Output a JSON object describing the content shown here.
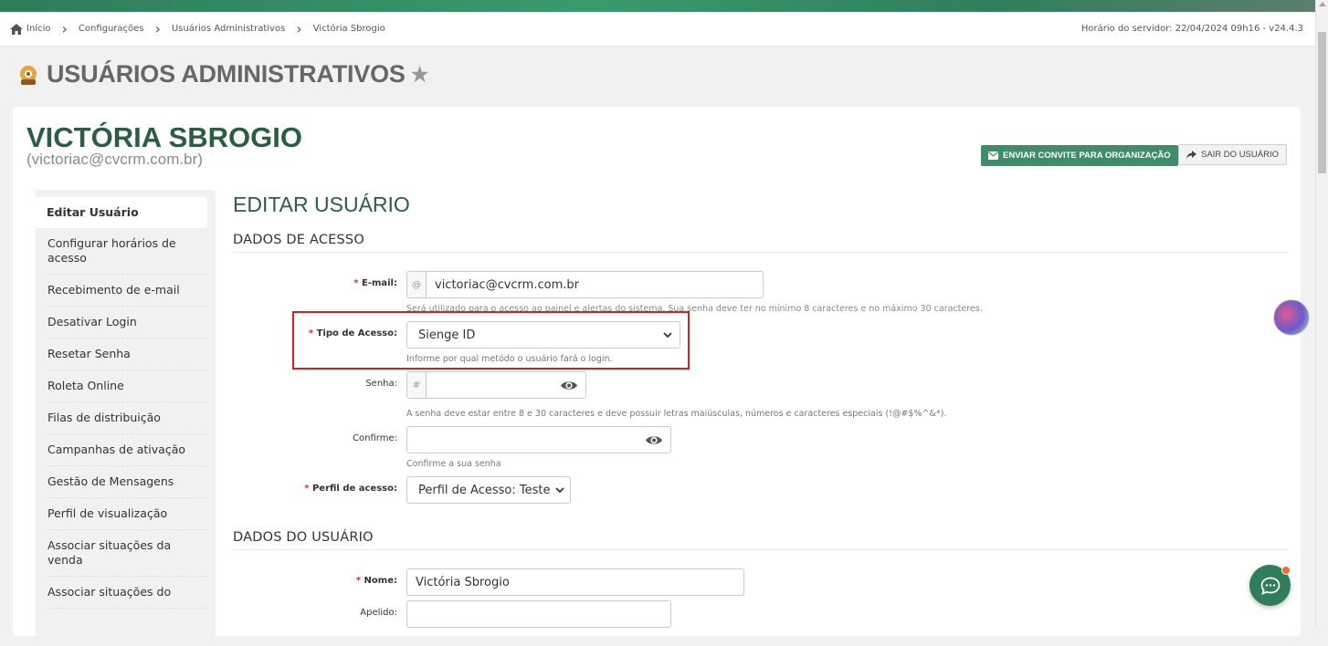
{
  "breadcrumb": {
    "items": [
      "Início",
      "Configurações",
      "Usuários Administrativos",
      "Victória Sbrogio"
    ],
    "server_time": "Horário do servidor: 22/04/2024 09h16 - v24.4.3"
  },
  "header": {
    "title": "USUÁRIOS ADMINISTRATIVOS"
  },
  "user": {
    "name": "VICTÓRIA SBROGIO",
    "email": "(victoriac@cvcrm.com.br)",
    "invite_button": "ENVIAR CONVITE PARA ORGANIZAÇÃO",
    "logout_button": "SAIR DO USUÁRIO"
  },
  "sidebar": {
    "items": [
      {
        "label": "Editar Usuário",
        "active": true
      },
      {
        "label": "Configurar horários de acesso"
      },
      {
        "label": "Recebimento de e-mail"
      },
      {
        "label": "Desativar Login"
      },
      {
        "label": "Resetar Senha"
      },
      {
        "label": "Roleta Online"
      },
      {
        "label": "Filas de distribuição"
      },
      {
        "label": "Campanhas de ativação"
      },
      {
        "label": "Gestão de Mensagens"
      },
      {
        "label": "Perfil de visualização"
      },
      {
        "label": "Associar situações da venda"
      },
      {
        "label": "Associar situações do"
      }
    ]
  },
  "form": {
    "heading": "EDITAR USUÁRIO",
    "section_access": "DADOS DE ACESSO",
    "section_user": "DADOS DO USUÁRIO",
    "email": {
      "label": "E-mail:",
      "addon": "@",
      "value": "victoriac@cvcrm.com.br",
      "help": "Será utilizado para o acesso ao painel e alertas do sistema. Sua senha deve ter no mínimo 8 caracteres e no máximo 30 caracteres."
    },
    "access_type": {
      "label": "Tipo de Acesso:",
      "value": "Sienge ID",
      "help": "Informe por qual metódo o usuário fará o login."
    },
    "password": {
      "label": "Senha:",
      "addon": "#",
      "help": "A senha deve estar entre 8 e 30 caracteres e deve possuir letras maiúsculas, números e caracteres especiais (!@#$%^&*)."
    },
    "confirm": {
      "label": "Confirme:",
      "help": "Confirme a sua senha"
    },
    "profile": {
      "label": "Perfil de acesso:",
      "value": "Perfil de Acesso: Teste"
    },
    "name": {
      "label": "Nome:",
      "value": "Victória Sbrogio"
    },
    "nickname": {
      "label": "Apelido:",
      "value": ""
    },
    "required_mark": "*"
  },
  "colors": {
    "brand": "#2b5d45",
    "button": "#3e8d6a",
    "highlight": "#e01d1d",
    "chat_badge": "#f06a27"
  }
}
